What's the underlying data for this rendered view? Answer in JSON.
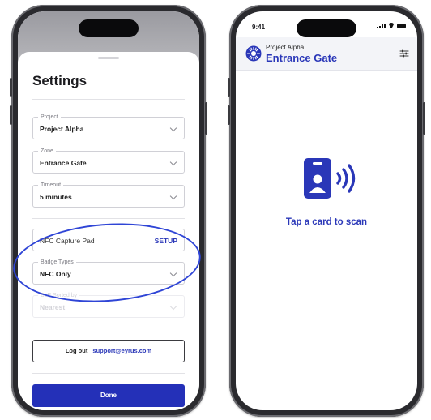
{
  "settings": {
    "title": "Settings",
    "fields": {
      "project": {
        "label": "Project",
        "value": "Project Alpha"
      },
      "zone": {
        "label": "Zone",
        "value": "Entrance Gate"
      },
      "timeout": {
        "label": "Timeout",
        "value": "5 minutes"
      },
      "badge_types": {
        "label": "Badge Types",
        "value": "NFC Only"
      },
      "ble_sorted_by": {
        "label": "BLE Sorted by",
        "value": "Nearest"
      }
    },
    "nfc_capture_pad": {
      "label": "NFC Capture Pad",
      "action": "SETUP"
    },
    "logout": {
      "label": "Log out",
      "email": "support@eyrus.com"
    },
    "done_label": "Done"
  },
  "scan_screen": {
    "status_time": "9:41",
    "project_name": "Project Alpha",
    "zone_name": "Entrance Gate",
    "prompt": "Tap a card to scan",
    "icons": [
      "filter-icon",
      "badge-nfc-icon",
      "logo-icon"
    ]
  },
  "colors": {
    "accent": "#2a37b8",
    "primary_button": "#2430b8",
    "highlight_ring": "#2f45d6"
  }
}
